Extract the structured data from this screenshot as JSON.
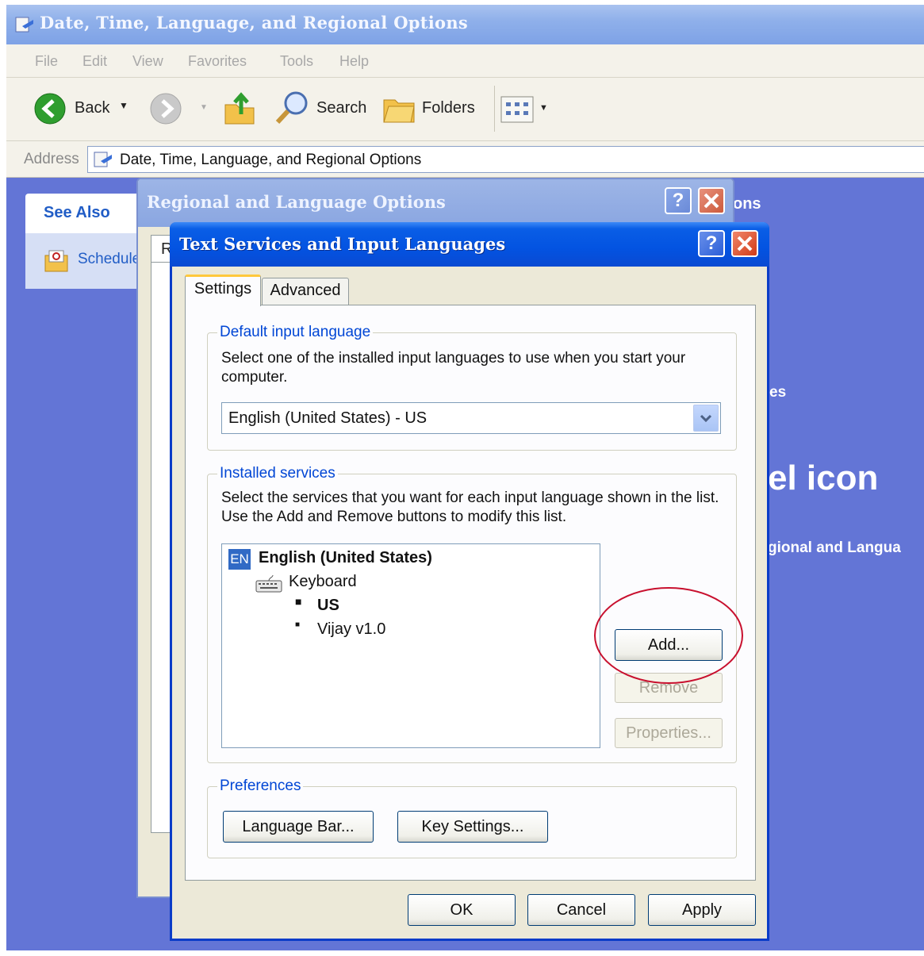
{
  "explorer": {
    "title": "Date, Time, Language, and Regional Options",
    "menu": [
      "File",
      "Edit",
      "View",
      "Favorites",
      "Tools",
      "Help"
    ],
    "toolbar": {
      "back_label": "Back",
      "search_label": "Search",
      "folders_label": "Folders"
    },
    "address": {
      "label": "Address",
      "value": "Date, Time, Language, and Regional Options"
    },
    "see_also": {
      "heading": "See Also",
      "item": "Schedule"
    },
    "background_fragments": {
      "title_tail": "ons",
      "es": "es",
      "panel_icon": "el icon",
      "regional_link": "gional and Langua"
    }
  },
  "regional_dialog": {
    "title": "Regional and Language Options",
    "tab_fragment": "R"
  },
  "textsvc_dialog": {
    "title": "Text Services and Input Languages",
    "tabs": [
      "Settings",
      "Advanced"
    ],
    "default_input": {
      "legend": "Default input language",
      "description": "Select one of the installed input languages to use when you start your computer.",
      "selected": "English (United States) - US"
    },
    "installed_services": {
      "legend": "Installed services",
      "description": "Select the services that you want for each input language shown in the list. Use the Add and Remove buttons to modify this list.",
      "language_badge": "EN",
      "language": "English (United States)",
      "category": "Keyboard",
      "layouts": [
        "US",
        "Vijay v1.0"
      ],
      "add_label": "Add...",
      "remove_label": "Remove",
      "properties_label": "Properties..."
    },
    "preferences": {
      "legend": "Preferences",
      "language_bar_label": "Language Bar...",
      "key_settings_label": "Key Settings..."
    },
    "footer": {
      "ok_label": "OK",
      "cancel_label": "Cancel",
      "apply_label": "Apply"
    }
  },
  "colors": {
    "xp_title_blue": "#0353e1",
    "annotation_red": "#c8102e",
    "group_legend_blue": "#0046d5"
  }
}
